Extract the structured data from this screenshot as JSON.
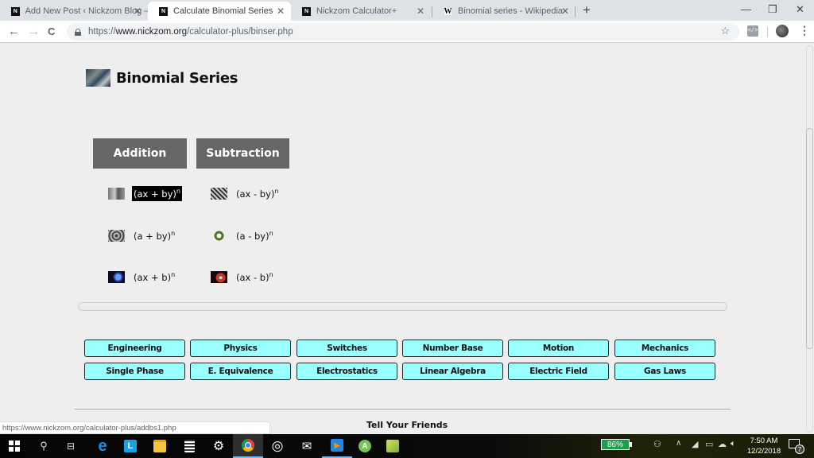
{
  "browser": {
    "tabs": [
      {
        "title": "Add New Post ‹ Nickzom Blog —",
        "favicon": "nickzom-icon",
        "active": false
      },
      {
        "title": "Calculate Binomial Series",
        "favicon": "nickzom-icon",
        "active": true
      },
      {
        "title": "Nickzom Calculator+",
        "favicon": "nickzom-icon",
        "active": false
      },
      {
        "title": "Binomial series - Wikipedia",
        "favicon": "wikipedia-icon",
        "active": false
      }
    ],
    "tab_close_glyph": "✕",
    "new_tab_glyph": "+",
    "window_controls": {
      "minimize": "—",
      "restore": "❐",
      "close": "✕"
    },
    "nav": {
      "back": "←",
      "forward": "→",
      "reload": "C"
    },
    "url": {
      "scheme": "https://",
      "host": "www.nickzom.org",
      "path": "/calculator-plus/binser.php"
    },
    "star_glyph": "☆",
    "extension_label": "</>",
    "menu_glyph": "⋮",
    "status_url": "https://www.nickzom.org/calculator-plus/addbs1.php"
  },
  "page": {
    "title": "Binomial Series",
    "categories": [
      {
        "label": "Addition"
      },
      {
        "label": "Subtraction"
      }
    ],
    "formulas": [
      {
        "base": "(ax + by)",
        "exp": "n",
        "selected": true,
        "icon": "gear-photo-icon"
      },
      {
        "base": "(ax - by)",
        "exp": "n",
        "selected": false,
        "icon": "pattern-icon"
      },
      {
        "base": "(a + by)",
        "exp": "n",
        "selected": false,
        "icon": "pattern-icon"
      },
      {
        "base": "(a - by)",
        "exp": "n",
        "selected": false,
        "icon": "green-wheel-icon"
      },
      {
        "base": "(ax + b)",
        "exp": "n",
        "selected": false,
        "icon": "blue-gears-icon"
      },
      {
        "base": "(ax - b)",
        "exp": "n",
        "selected": false,
        "icon": "red-gears-icon"
      }
    ],
    "links": [
      "Engineering",
      "Physics",
      "Switches",
      "Number Base",
      "Motion",
      "Mechanics",
      "Single Phase",
      "E. Equivalence",
      "Electrostatics",
      "Linear Algebra",
      "Electric Field",
      "Gas Laws"
    ],
    "footer_heading": "Tell Your Friends",
    "colors": {
      "category_bg": "#666666",
      "link_bg": "#99ffff",
      "link_border": "#222222"
    }
  },
  "taskbar": {
    "apps": [
      "start",
      "search",
      "task-view",
      "edge",
      "l-app",
      "file-explorer",
      "calculator",
      "settings",
      "chrome",
      "groove",
      "mail",
      "media-player",
      "android-studio",
      "notepad-plus"
    ],
    "battery_percent": "86%",
    "clock_time": "7:50 AM",
    "clock_date": "12/2/2018",
    "notification_count": "7"
  }
}
